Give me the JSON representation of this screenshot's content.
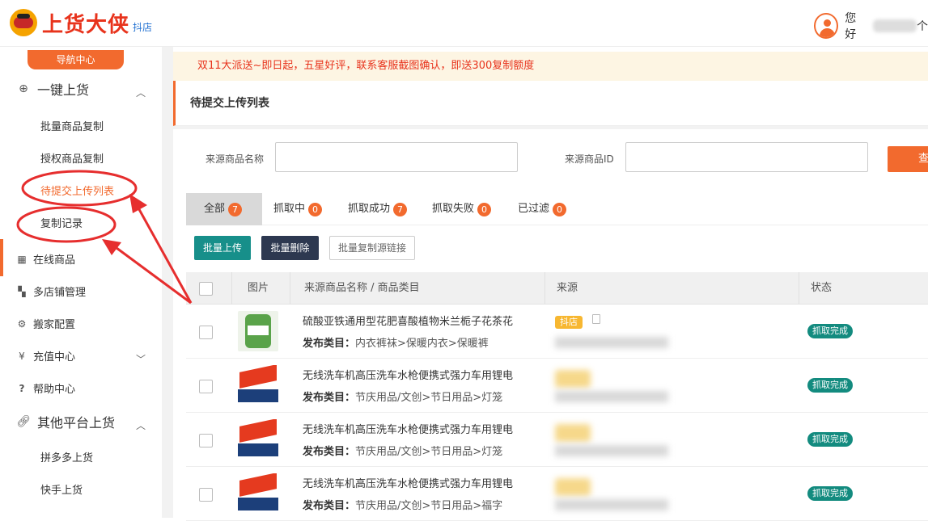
{
  "header": {
    "logo_text": "上货大侠",
    "logo_sub": "抖店",
    "greeting": "您好",
    "greeting_tail": "个"
  },
  "sidebar": {
    "nav_center": "导航中心",
    "group1": {
      "label": "一键上货",
      "icon": "upload-circle-icon"
    },
    "group1_items": [
      "批量商品复制",
      "授权商品复制",
      "待提交上传列表",
      "复制记录"
    ],
    "items": [
      {
        "label": "在线商品",
        "icon": "table-icon"
      },
      {
        "label": "多店铺管理",
        "icon": "grid-icon"
      },
      {
        "label": "搬家配置",
        "icon": "gear-icon"
      },
      {
        "label": "充值中心",
        "icon": "yen-circle-icon"
      },
      {
        "label": "帮助中心",
        "icon": "question-icon"
      }
    ],
    "group2": {
      "label": "其他平台上货",
      "icon": "link-icon"
    },
    "group2_items": [
      "拼多多上货",
      "快手上货"
    ]
  },
  "notice": "双11大派送~即日起，五星好评，联系客服截图确认，即送300复制额度",
  "panel_title": "待提交上传列表",
  "search": {
    "name_label": "来源商品名称",
    "id_label": "来源商品ID",
    "name_value": "",
    "id_value": "",
    "query_label": "查"
  },
  "tabs": [
    {
      "label": "全部",
      "count": "7"
    },
    {
      "label": "抓取中",
      "count": "0"
    },
    {
      "label": "抓取成功",
      "count": "7"
    },
    {
      "label": "抓取失败",
      "count": "0"
    },
    {
      "label": "已过滤",
      "count": "0"
    }
  ],
  "actions": {
    "batch_upload": "批量上传",
    "batch_delete": "批量删除",
    "batch_copy_link": "批量复制源链接"
  },
  "table": {
    "headers": [
      "图片",
      "来源商品名称 / 商品类目",
      "来源",
      "状态"
    ],
    "category_prefix": "发布类目：",
    "rows": [
      {
        "name": "硫酸亚铁通用型花肥喜酸植物米兰栀子花茶花",
        "category": "内衣裤袜>保暖内衣>保暖裤",
        "source_tag": "抖店",
        "status": "抓取完成"
      },
      {
        "name": "无线洗车机高压洗车水枪便携式强力车用锂电",
        "category": "节庆用品/文创>节日用品>灯笼",
        "source_tag": "",
        "status": "抓取完成"
      },
      {
        "name": "无线洗车机高压洗车水枪便携式强力车用锂电",
        "category": "节庆用品/文创>节日用品>灯笼",
        "source_tag": "",
        "status": "抓取完成"
      },
      {
        "name": "无线洗车机高压洗车水枪便携式强力车用锂电",
        "category": "节庆用品/文创>节日用品>福字",
        "source_tag": "",
        "status": "抓取完成"
      }
    ]
  },
  "colors": {
    "accent": "#f26a2e",
    "status": "#138b7f",
    "notice_text": "#e8331c",
    "annotation": "#e62e2e"
  }
}
